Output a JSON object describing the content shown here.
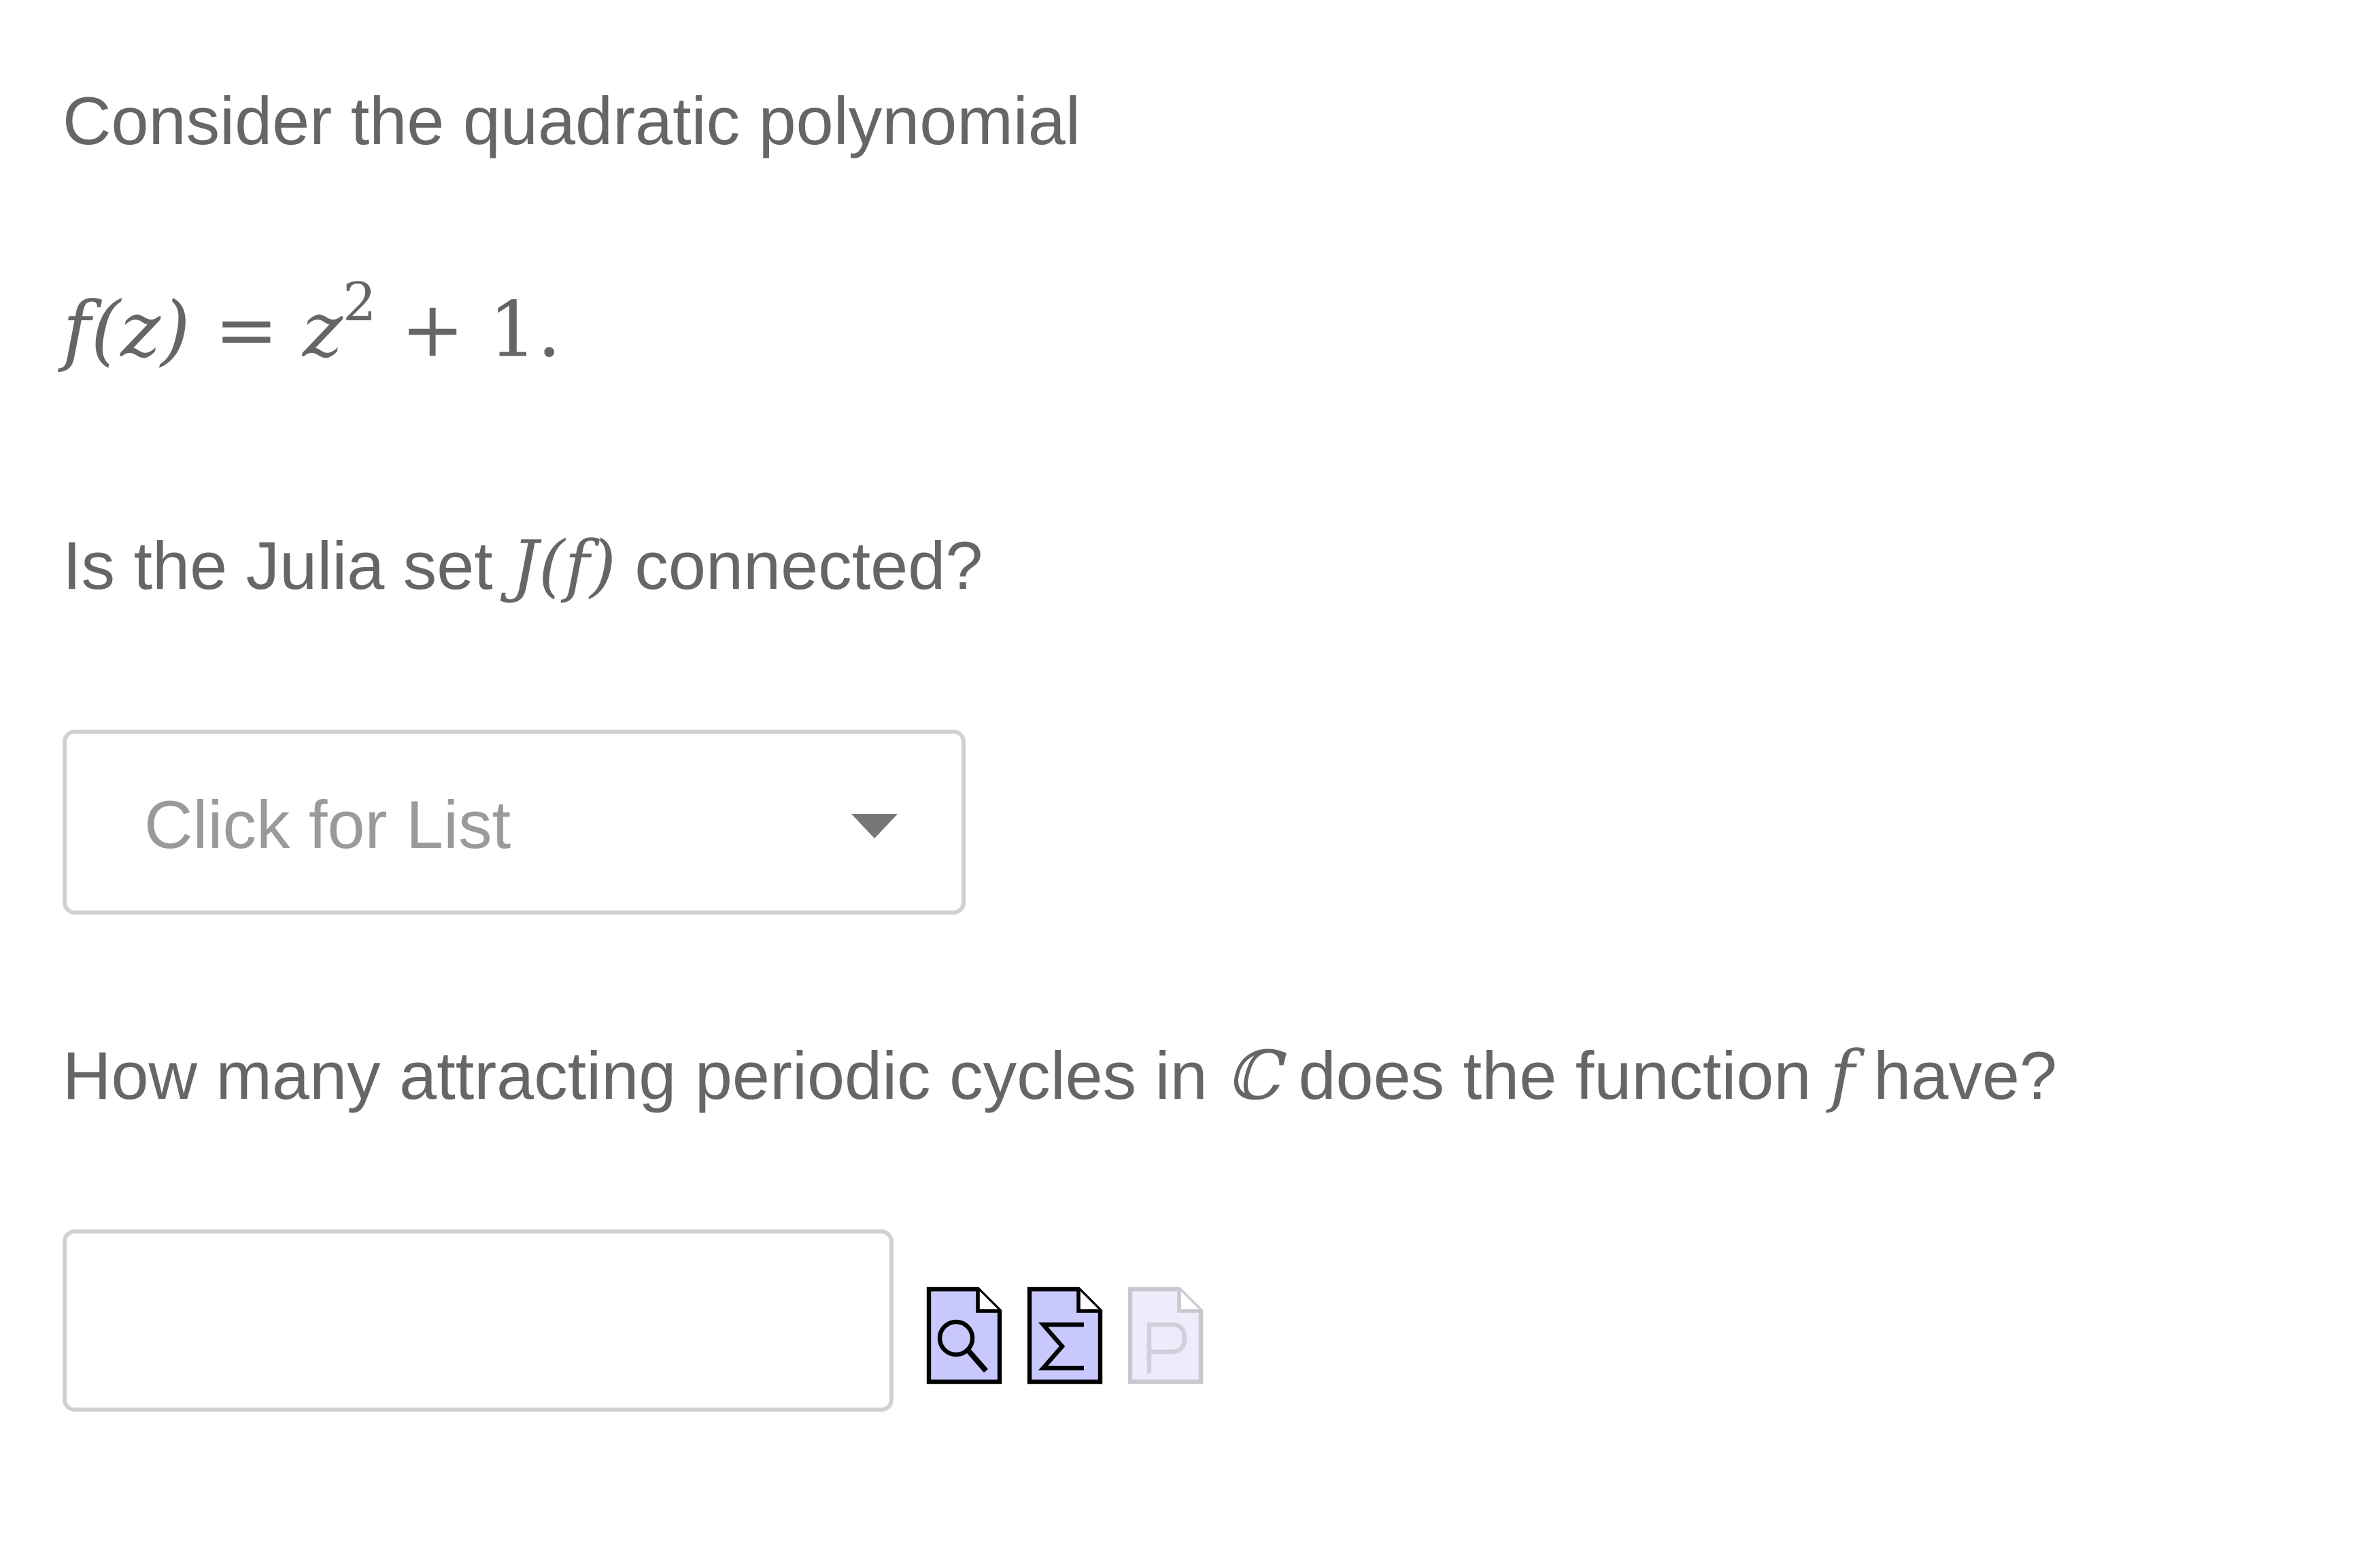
{
  "intro": {
    "text": "Consider the quadratic polynomial"
  },
  "equation": {
    "lhs": "f(z)",
    "equals": "=",
    "base": "z",
    "exponent": "2",
    "rest": "+ 1."
  },
  "question1": {
    "before": "Is the Julia set ",
    "math": "J(f)",
    "after": " connected?"
  },
  "dropdown": {
    "selected": "Click for List"
  },
  "question2": {
    "before": "How many attracting periodic cycles in ",
    "math1": "ℂ",
    "middle": " does the function ",
    "math2": "f",
    "after": " have?"
  },
  "answer": {
    "value": "",
    "placeholder": ""
  },
  "tools": {
    "preview_icon": "magnifier-document-icon",
    "equation_icon": "sigma-document-icon",
    "problem_icon": "p-document-icon",
    "active_color": "#c8c8ff",
    "disabled_color": "#ececfa"
  }
}
